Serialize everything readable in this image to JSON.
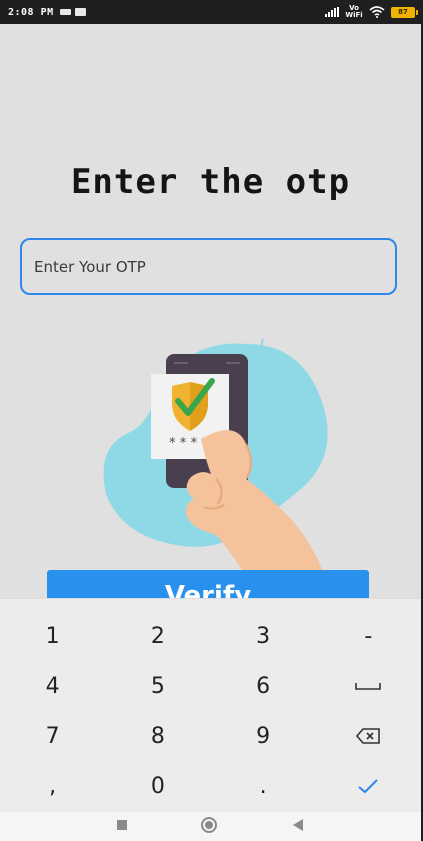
{
  "status_bar": {
    "time": "2:08 PM",
    "network_label": "Vo WiFi",
    "battery_level": "87",
    "icons": [
      "message-icon",
      "mail-icon",
      "signal-icon",
      "wifi-icon",
      "battery-icon"
    ]
  },
  "page": {
    "title": "Enter the otp",
    "otp_placeholder": "Enter Your OTP",
    "otp_value": "",
    "verify_label": "Verify"
  },
  "illustration": {
    "otp_mask": "****",
    "colors": {
      "blob": "#8fd9e6",
      "phone": "#4a3f4f",
      "hand": "#f4c29b",
      "shield": "#f1b232",
      "check": "#39a64a"
    }
  },
  "keyboard": {
    "keys": [
      {
        "label": "1",
        "type": "digit"
      },
      {
        "label": "2",
        "type": "digit"
      },
      {
        "label": "3",
        "type": "digit"
      },
      {
        "label": "-",
        "type": "symbol"
      },
      {
        "label": "4",
        "type": "digit"
      },
      {
        "label": "5",
        "type": "digit"
      },
      {
        "label": "6",
        "type": "digit"
      },
      {
        "label": "",
        "type": "space",
        "icon": "space-icon"
      },
      {
        "label": "7",
        "type": "digit"
      },
      {
        "label": "8",
        "type": "digit"
      },
      {
        "label": "9",
        "type": "digit"
      },
      {
        "label": "",
        "type": "backspace",
        "icon": "backspace-icon"
      },
      {
        "label": ",",
        "type": "symbol"
      },
      {
        "label": "0",
        "type": "digit"
      },
      {
        "label": ".",
        "type": "symbol"
      },
      {
        "label": "",
        "type": "done",
        "icon": "checkmark-icon"
      }
    ]
  },
  "nav_bar": {
    "buttons": [
      "recents-square-icon",
      "home-circle-icon",
      "back-triangle-icon"
    ]
  },
  "colors": {
    "accent": "#2f86e8",
    "button": "#2990ee",
    "background": "#e0e0e0",
    "keyboard": "#ececec"
  }
}
